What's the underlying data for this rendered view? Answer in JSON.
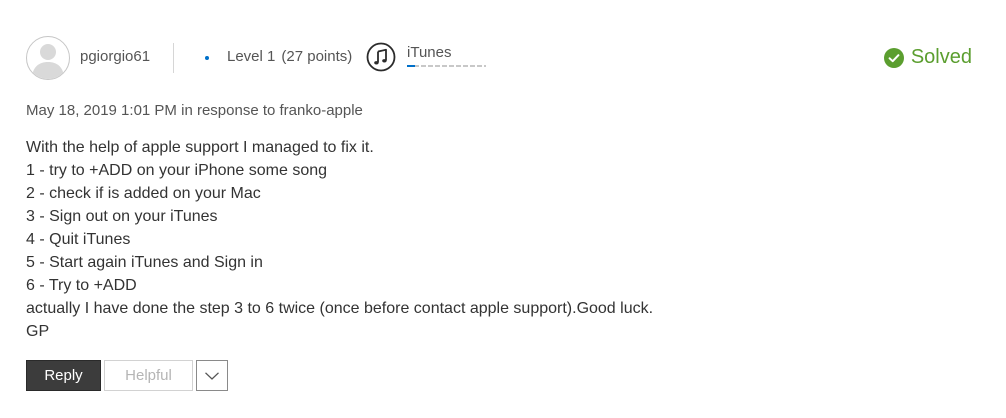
{
  "author": {
    "avatar_icon": "default-user-avatar-icon",
    "username": "pgiorgio61",
    "level": "Level 1",
    "points": "(27 points)",
    "level_progress": 0.1
  },
  "community": {
    "icon": "itunes-music-note-icon",
    "name": "iTunes"
  },
  "status": {
    "icon": "checkmark-circle-icon",
    "label": "Solved",
    "color": "#5b9e2f"
  },
  "meta": {
    "timestamp": "May 18, 2019 1:01 PM",
    "in_response_to_prefix": "in response to",
    "in_response_to_user": "franko-apple"
  },
  "post": {
    "lines": [
      "With the help of apple support I managed to fix it.",
      "1 - try to +ADD on your iPhone some song",
      "2 - check if is added on your Mac",
      "3 - Sign out on your iTunes",
      "4 - Quit iTunes",
      "5 - Start again iTunes and Sign in",
      "6 - Try to +ADD",
      "actually I have done the step 3 to 6 twice (once before contact apple support).Good luck.",
      "GP"
    ]
  },
  "actions": {
    "reply_label": "Reply",
    "helpful_label": "Helpful",
    "more_icon": "chevron-down-icon"
  },
  "colors": {
    "accent": "#0070c9",
    "reply_bg": "#3c3c3c",
    "solved": "#5b9e2f"
  }
}
